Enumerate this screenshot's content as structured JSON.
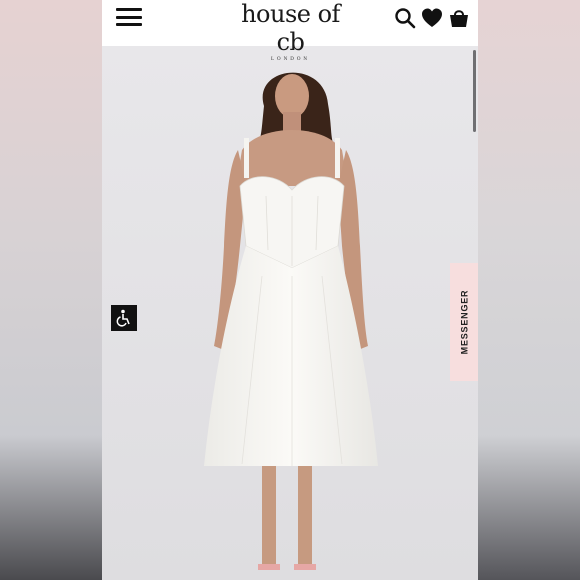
{
  "header": {
    "logo_text": "house of cb",
    "logo_subtext": "LONDON",
    "menu_icon": "hamburger-menu-icon",
    "search_icon": "search-icon",
    "wishlist_icon": "heart-icon",
    "bag_icon": "shopping-bag-icon"
  },
  "widgets": {
    "accessibility_icon": "wheelchair-accessibility-icon",
    "messenger_label": "MESSENGER"
  },
  "colors": {
    "header_bg": "#ffffff",
    "messenger_bg": "#f7dede",
    "dress": "#f7f6f3",
    "backdrop": "#e4e3e6"
  }
}
